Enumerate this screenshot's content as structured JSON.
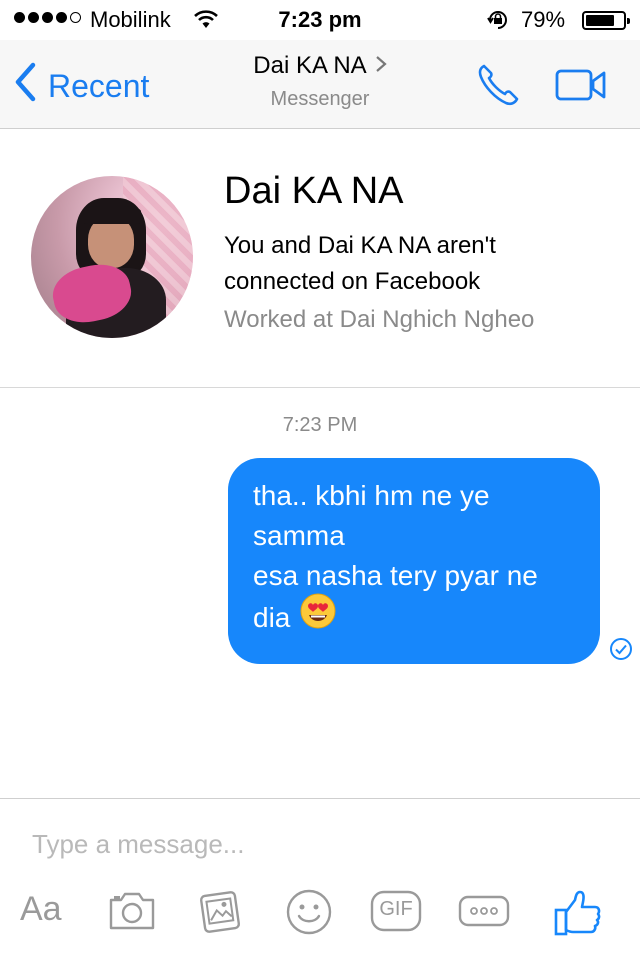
{
  "status_bar": {
    "carrier": "Mobilink",
    "time": "7:23 pm",
    "battery": "79%",
    "battery_level": 0.79,
    "signal_bars": 4,
    "signal_max": 5
  },
  "nav": {
    "back_label": "Recent",
    "title": "Dai KA NA",
    "subtitle": "Messenger"
  },
  "profile": {
    "name": "Dai KA NA",
    "connection_note": "You and Dai KA NA aren't connected on Facebook",
    "work": "Worked at Dai Nghich Ngheo"
  },
  "conversation": {
    "timestamp": "7:23 PM",
    "message_line1": "tha.. kbhi hm ne ye samma",
    "message_line2": "esa nasha tery pyar ne dia"
  },
  "composer": {
    "placeholder": "Type a message...",
    "aa_label": "Aa",
    "gif_label": "GIF"
  },
  "colors": {
    "accent": "#1a7df0",
    "bubble": "#1787fb",
    "muted": "#8a8a8a",
    "tool_gray": "#9a9a9a"
  },
  "icons": [
    "back-chevron-icon",
    "phone-icon",
    "video-icon",
    "seen-check-icon",
    "camera-icon",
    "photo-icon",
    "emoji-icon",
    "gif-icon",
    "more-icon",
    "like-icon",
    "heart-eyes-emoji"
  ]
}
